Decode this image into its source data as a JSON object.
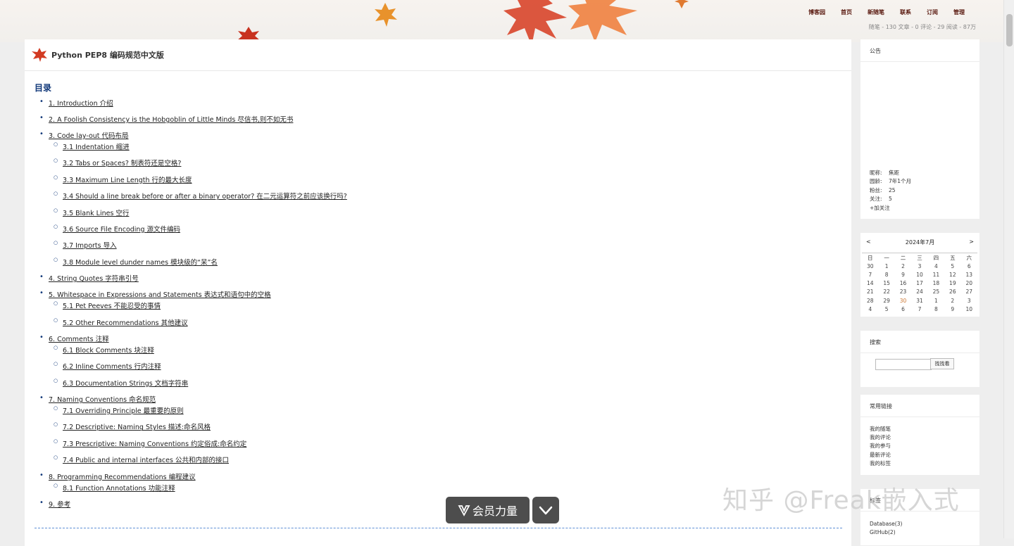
{
  "header": {
    "nav": [
      "博客园",
      "首页",
      "新随笔",
      "联系",
      "订阅",
      "管理"
    ],
    "stats": "随笔 - 130  文章 - 0  评论 - 29  阅读 - 87万"
  },
  "post": {
    "title": "Python PEP8 编码规范中文版",
    "toc_heading": "目录",
    "toc": [
      {
        "label": "1. Introduction 介绍",
        "children": []
      },
      {
        "label": "2. A Foolish Consistency is the Hobgoblin of Little Minds 尽信书,则不如无书",
        "children": []
      },
      {
        "label": "3. Code lay-out 代码布局",
        "children": [
          "3.1 Indentation 缩进",
          "3.2 Tabs or Spaces?  制表符还是空格?",
          "3.3 Maximum Line Length 行的最大长度",
          "3.4 Should a line break before or after a binary operator? 在二元运算符之前应该换行吗?",
          "3.5 Blank Lines 空行",
          "3.6 Source File Encoding 源文件编码",
          "3.7 Imports 导入",
          "3.8 Module level dunder names 模块级的“呆”名"
        ]
      },
      {
        "label": "4. String Quotes 字符串引号",
        "children": []
      },
      {
        "label": "5. Whitespace in Expressions and Statements 表达式和语句中的空格",
        "children": [
          "5.1 Pet Peeves 不能忍受的事情",
          "5.2 Other Recommendations 其他建议"
        ]
      },
      {
        "label": "6. Comments 注释",
        "children": [
          "6.1 Block Comments 块注释",
          "6.2 Inline Comments 行内注释",
          "6.3 Documentation Strings 文档字符串"
        ]
      },
      {
        "label": "7. Naming Conventions 命名规范",
        "children": [
          "7.1 Overriding Principle 最重要的原则",
          "7.2 Descriptive: Naming Styles 描述:命名风格",
          "7.3 Prescriptive: Naming Conventions 约定俗成:命名约定",
          "7.4 Public and internal interfaces 公共和内部的接口"
        ]
      },
      {
        "label": "8. Programming Recommendations 编程建议",
        "children": [
          "8.1 Function Annotations 功能注释"
        ]
      },
      {
        "label": "9. 参考",
        "children": []
      }
    ]
  },
  "sidebar": {
    "notice": {
      "title": "公告",
      "profile": [
        {
          "k": "昵称:",
          "v": "焦距"
        },
        {
          "k": "园龄:",
          "v": "7年1个月"
        },
        {
          "k": "粉丝:",
          "v": "25"
        },
        {
          "k": "关注:",
          "v": "5"
        }
      ],
      "follow": "+加关注"
    },
    "calendar": {
      "prev": "<",
      "next": ">",
      "month": "2024年7月",
      "weekdays": [
        "日",
        "一",
        "二",
        "三",
        "四",
        "五",
        "六"
      ],
      "weeks": [
        [
          "30",
          "1",
          "2",
          "3",
          "4",
          "5",
          "6"
        ],
        [
          "7",
          "8",
          "9",
          "10",
          "11",
          "12",
          "13"
        ],
        [
          "14",
          "15",
          "16",
          "17",
          "18",
          "19",
          "20"
        ],
        [
          "21",
          "22",
          "23",
          "24",
          "25",
          "26",
          "27"
        ],
        [
          "28",
          "29",
          "30",
          "31",
          "1",
          "2",
          "3"
        ],
        [
          "4",
          "5",
          "6",
          "7",
          "8",
          "9",
          "10"
        ]
      ],
      "today": "30"
    },
    "search": {
      "title": "搜索",
      "button": "找找看",
      "value": ""
    },
    "links": {
      "title": "常用链接",
      "items": [
        "我的随笔",
        "我的评论",
        "我的参与",
        "最新评论",
        "我的标签"
      ]
    },
    "tags": {
      "title": "标签",
      "items": [
        "Database(3)",
        "GitHub(2)"
      ]
    }
  },
  "overlay": {
    "vip_label": "会员力量",
    "watermark": "知乎 @Freak嵌入式"
  }
}
